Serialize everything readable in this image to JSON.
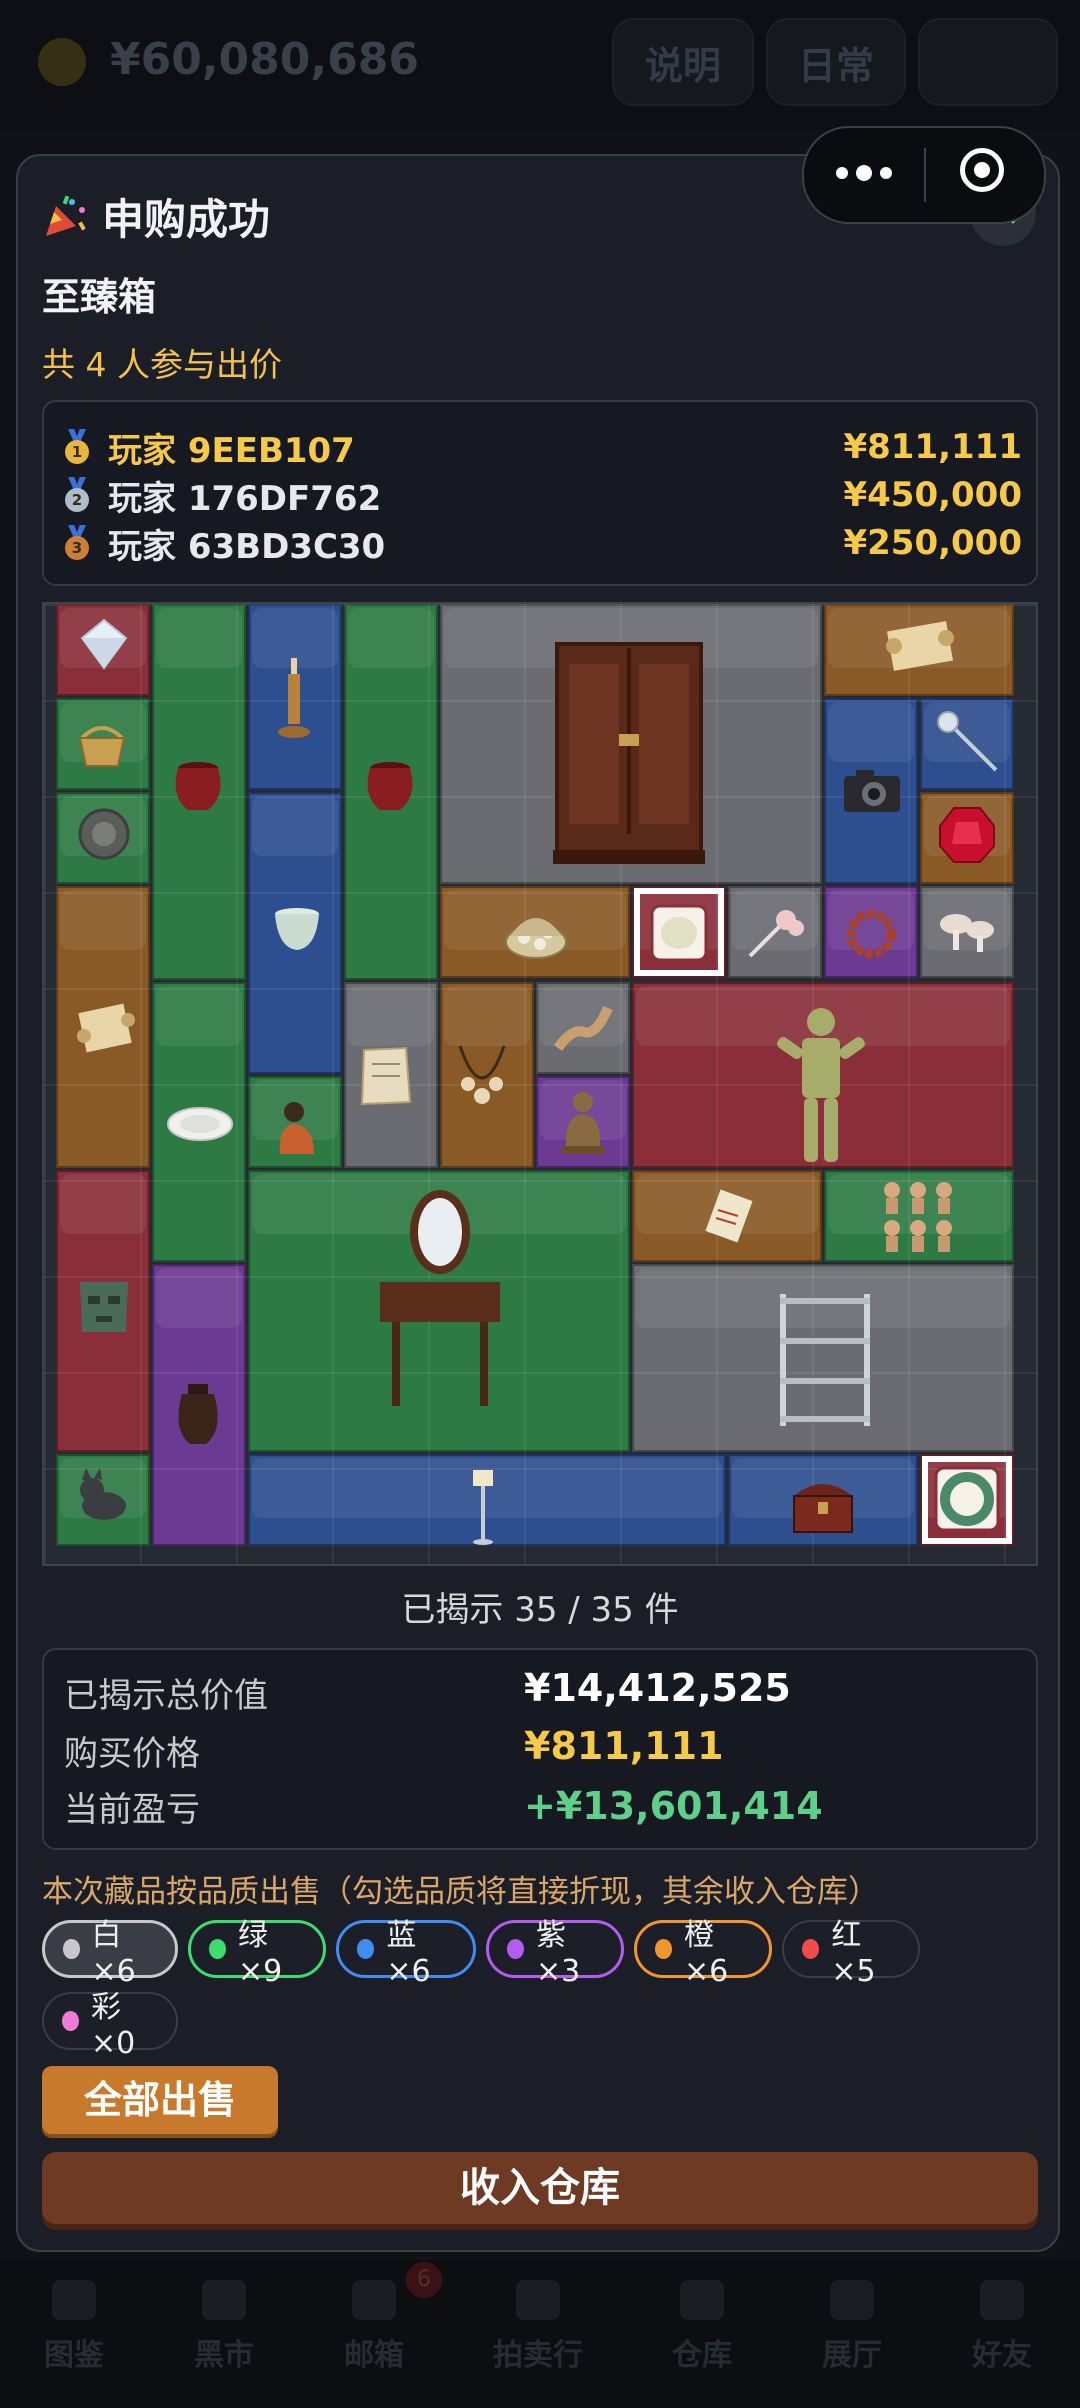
{
  "background": {
    "money": "¥60,080,686",
    "pills": [
      "说明",
      "日常",
      ""
    ],
    "nav": [
      {
        "label": "图鉴"
      },
      {
        "label": "黑市"
      },
      {
        "label": "邮箱",
        "badge": "6"
      },
      {
        "label": "拍卖行"
      },
      {
        "label": "仓库"
      },
      {
        "label": "展厅"
      },
      {
        "label": "好友"
      }
    ]
  },
  "dialog": {
    "title": "申购成功",
    "close_label": "×",
    "box_name": "至臻箱",
    "participants": "共 4 人参与出价",
    "bids": [
      {
        "rank": "1",
        "name": "玩家 9EEB107",
        "amount": "¥811,111",
        "name_color": "#f7c948",
        "medal_color": "#e8b63a"
      },
      {
        "rank": "2",
        "name": "玩家 176DF762",
        "amount": "¥450,000",
        "name_color": "#e8e8ea",
        "medal_color": "#aebccc"
      },
      {
        "rank": "3",
        "name": "玩家 63BD3C30",
        "amount": "¥250,000",
        "name_color": "#e8e8ea",
        "medal_color": "#cd7f3a"
      }
    ],
    "revealed": "已揭示 35 / 35 件",
    "summary": {
      "total_label": "已揭示总价值",
      "total_value": "¥14,412,525",
      "price_label": "购买价格",
      "price_value": "¥811,111",
      "pnl_label": "当前盈亏",
      "pnl_value": "+¥13,601,414"
    },
    "sell_note": "本次藏品按品质出售（勾选品质将直接折现，其余收入仓库）",
    "quality_chips": [
      {
        "label": "白×6",
        "color": "#c8c8cc",
        "border": "#c8c8cc",
        "bg": "#3a3d45",
        "selected": true
      },
      {
        "label": "绿×9",
        "color": "#3ddc6e",
        "border": "#3ddc6e",
        "bg": "#1c1f27",
        "selected": true
      },
      {
        "label": "蓝×6",
        "color": "#3f8cf2",
        "border": "#3f8cf2",
        "bg": "#1c1f27",
        "selected": true
      },
      {
        "label": "紫×3",
        "color": "#b25cf0",
        "border": "#b25cf0",
        "bg": "#1c1f27",
        "selected": true
      },
      {
        "label": "橙×6",
        "color": "#f0962e",
        "border": "#f0962e",
        "bg": "#1c1f27",
        "selected": true
      },
      {
        "label": "红×5",
        "color": "#f04a4a",
        "border": "#3a3d45",
        "bg": "#1c1f27",
        "selected": false
      },
      {
        "label": "彩×0",
        "color": "#f07ad6",
        "border": "#3a3d45",
        "bg": "#1c1f27",
        "selected": false
      }
    ],
    "sell_all_label": "全部出售",
    "store_label": "收入仓库"
  },
  "grid_items": [
    {
      "name": "diamond",
      "quality": "red"
    },
    {
      "name": "candlestick",
      "quality": "blue"
    },
    {
      "name": "wooden-wardrobe",
      "quality": "gray"
    },
    {
      "name": "map-scroll",
      "quality": "orange"
    },
    {
      "name": "wicker-basket",
      "quality": "green"
    },
    {
      "name": "red-clay-jar",
      "quality": "green"
    },
    {
      "name": "red-clay-jar",
      "quality": "green"
    },
    {
      "name": "camera",
      "quality": "blue"
    },
    {
      "name": "scepter",
      "quality": "blue"
    },
    {
      "name": "bronze-mirror",
      "quality": "green"
    },
    {
      "name": "ruby",
      "quality": "orange"
    },
    {
      "name": "celadon-bowl",
      "quality": "blue"
    },
    {
      "name": "jewel-box",
      "quality": "orange"
    },
    {
      "name": "jade-pendant",
      "quality": "red"
    },
    {
      "name": "hairpin",
      "quality": "gray"
    },
    {
      "name": "bead-bracelet",
      "quality": "purple"
    },
    {
      "name": "mushrooms",
      "quality": "gray"
    },
    {
      "name": "scroll",
      "quality": "orange"
    },
    {
      "name": "old-paper",
      "quality": "gray"
    },
    {
      "name": "shell-necklace",
      "quality": "orange"
    },
    {
      "name": "rope-knot",
      "quality": "gray"
    },
    {
      "name": "jade-burial-suit",
      "quality": "red"
    },
    {
      "name": "white-plate",
      "quality": "green"
    },
    {
      "name": "figurine",
      "quality": "green"
    },
    {
      "name": "buddha-statue",
      "quality": "purple"
    },
    {
      "name": "bronze-mask",
      "quality": "red"
    },
    {
      "name": "vanity-table",
      "quality": "green"
    },
    {
      "name": "document-scroll",
      "quality": "orange"
    },
    {
      "name": "terracotta-figures",
      "quality": "green"
    },
    {
      "name": "dark-urn",
      "quality": "purple"
    },
    {
      "name": "metal-shelf",
      "quality": "gray"
    },
    {
      "name": "stone-dog",
      "quality": "green"
    },
    {
      "name": "floor-lamp",
      "quality": "blue"
    },
    {
      "name": "treasure-chest",
      "quality": "blue"
    },
    {
      "name": "jade-disc",
      "quality": "red"
    }
  ]
}
